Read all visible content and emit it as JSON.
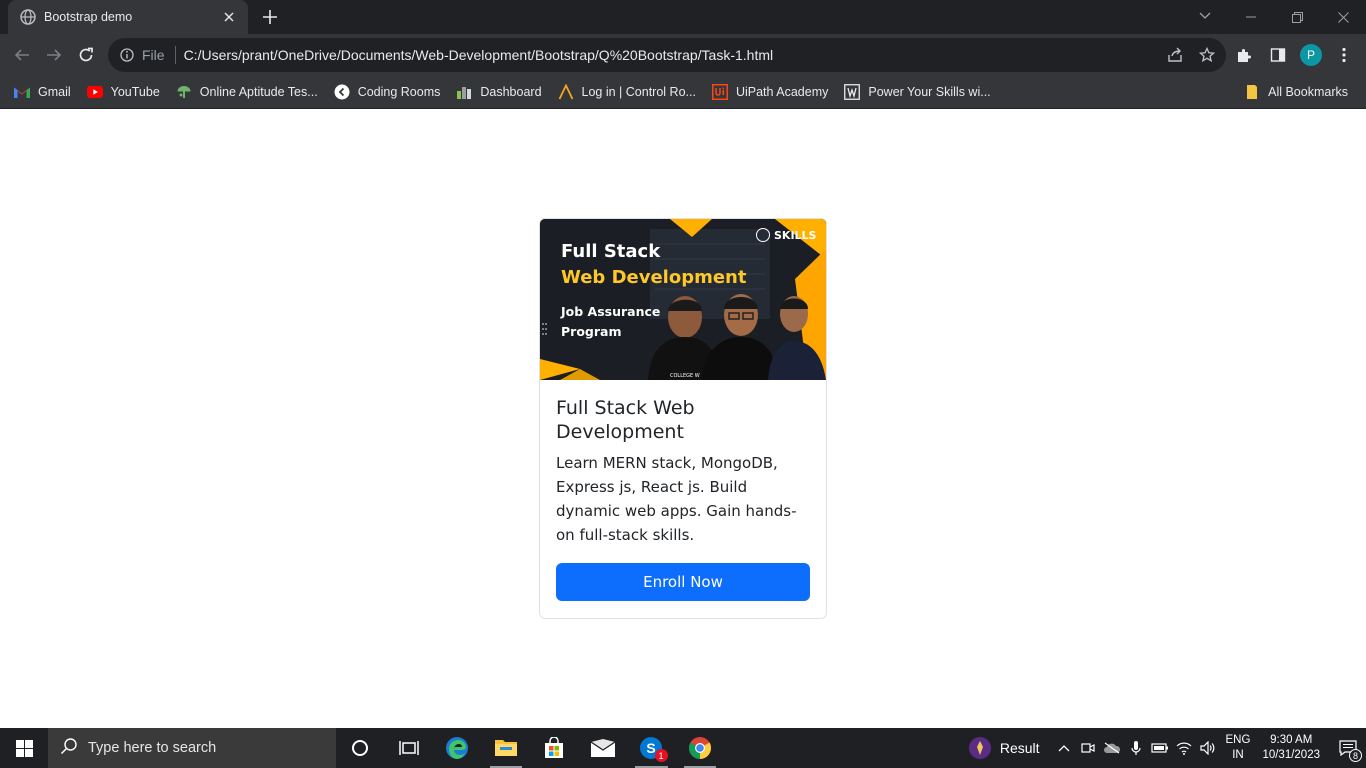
{
  "browser": {
    "tab": {
      "title": "Bootstrap demo"
    },
    "omnibox": {
      "chip": "File",
      "url": "C:/Users/prant/OneDrive/Documents/Web-Development/Bootstrap/Q%20Bootstrap/Task-1.html"
    },
    "profile_initial": "P",
    "bookmarks": [
      {
        "label": "Gmail",
        "icon": "gmail-icon"
      },
      {
        "label": "YouTube",
        "icon": "youtube-icon"
      },
      {
        "label": "Online Aptitude Tes...",
        "icon": "aptitude-icon"
      },
      {
        "label": "Coding Rooms",
        "icon": "coding-rooms-icon"
      },
      {
        "label": "Dashboard",
        "icon": "dashboard-icon"
      },
      {
        "label": "Log in | Control Ro...",
        "icon": "control-room-icon"
      },
      {
        "label": "UiPath Academy",
        "icon": "uipath-icon"
      },
      {
        "label": "Power Your Skills wi...",
        "icon": "skills-icon"
      }
    ],
    "all_bookmarks": "All Bookmarks"
  },
  "card": {
    "image": {
      "line1": "Full Stack",
      "line2": "Web Development",
      "line3": "Job Assurance Program",
      "brand": "SKILLS",
      "caption": "COLLEGE W"
    },
    "title": "Full Stack Web Development",
    "text": "Learn MERN stack, MongoDB, Express js, React js. Build dynamic web apps. Gain hands-on full-stack skills.",
    "button": "Enroll Now"
  },
  "taskbar": {
    "search_placeholder": "Type here to search",
    "skype_badge": "1",
    "result_label": "Result",
    "language": {
      "line1": "ENG",
      "line2": "IN"
    },
    "clock": {
      "time": "9:30 AM",
      "date": "10/31/2023"
    },
    "notification_count": "8"
  },
  "colors": {
    "primary_button": "#0d6efd",
    "chrome_dark": "#202124",
    "chrome_toolbar": "#35363a",
    "profile": "#0d97a4"
  }
}
